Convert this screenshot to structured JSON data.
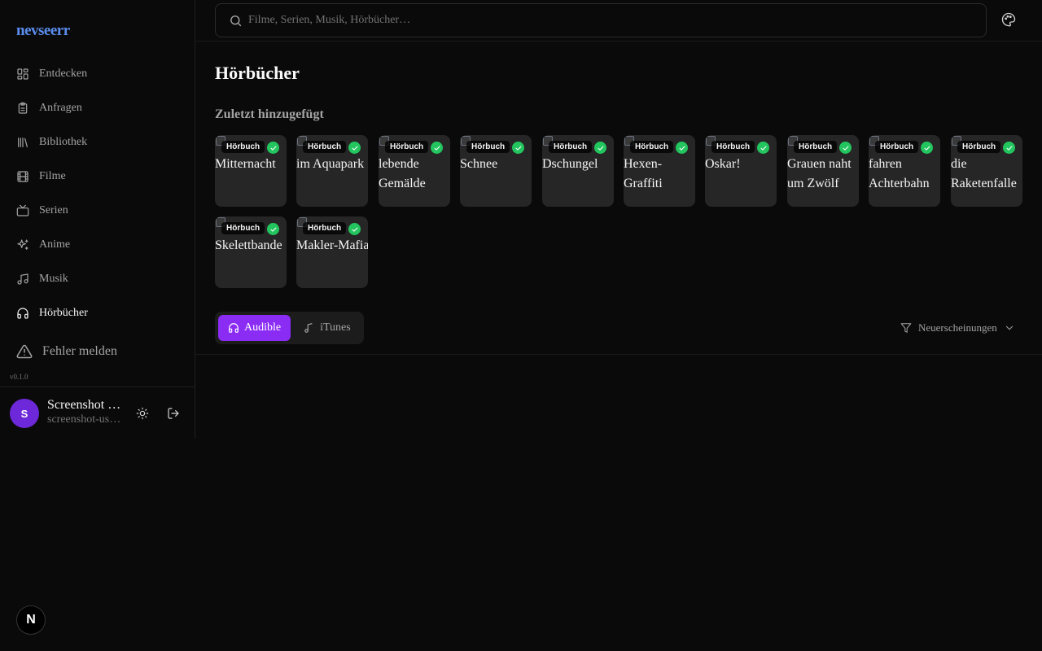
{
  "app": {
    "logo": "nevseerr",
    "version": "v0.1.0"
  },
  "sidebar": {
    "items": [
      {
        "label": "Entdecken",
        "icon": "layout-grid-icon",
        "active": false
      },
      {
        "label": "Anfragen",
        "icon": "clipboard-icon",
        "active": false
      },
      {
        "label": "Bibliothek",
        "icon": "library-icon",
        "active": false
      },
      {
        "label": "Filme",
        "icon": "film-icon",
        "active": false
      },
      {
        "label": "Serien",
        "icon": "tv-icon",
        "active": false
      },
      {
        "label": "Anime",
        "icon": "sparkles-icon",
        "active": false
      },
      {
        "label": "Musik",
        "icon": "music-icon",
        "active": false
      },
      {
        "label": "Hörbücher",
        "icon": "headphones-icon",
        "active": true
      }
    ],
    "report_label": "Fehler melden"
  },
  "user": {
    "initial": "S",
    "name": "Screenshot User",
    "email": "screenshot-user@example.com"
  },
  "search": {
    "placeholder": "Filme, Serien, Musik, Hörbücher…",
    "value": ""
  },
  "main": {
    "title": "Hörbücher",
    "section_title": "Zuletzt hinzugefügt",
    "badge_label": "Hörbuch",
    "cards": [
      {
        "title": "Mitternacht"
      },
      {
        "title": "im Aquapark"
      },
      {
        "title": "lebende Gemälde"
      },
      {
        "title": "Schnee"
      },
      {
        "title": "Dschungel"
      },
      {
        "title": "Hexen-Graffiti"
      },
      {
        "title": "Oskar!"
      },
      {
        "title": "Grauen naht um Zwölf"
      },
      {
        "title": "fahren Achterbahn"
      },
      {
        "title": "die Raketenfalle"
      },
      {
        "title": "Skelettbande"
      },
      {
        "title": "Makler-Mafia"
      }
    ],
    "tabs": [
      {
        "label": "Audible",
        "active": true
      },
      {
        "label": "iTunes",
        "active": false
      }
    ],
    "filter_label": "Neuerscheinungen"
  },
  "colors": {
    "accent": "#8b2cf5",
    "logo": "#5b8def",
    "check": "#22c55e",
    "background": "#0a0a0a"
  }
}
